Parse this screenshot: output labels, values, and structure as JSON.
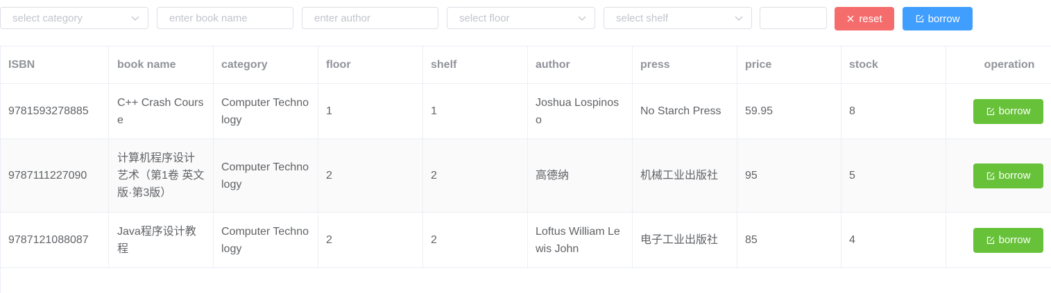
{
  "filters": {
    "category_placeholder": "select category",
    "book_name_placeholder": "enter book name",
    "author_placeholder": "enter author",
    "floor_placeholder": "select floor",
    "shelf_placeholder": "select shelf",
    "extra_value": ""
  },
  "buttons": {
    "reset_label": "reset",
    "borrow_label": "borrow"
  },
  "icons": {
    "select_arrow": "chevron-down-icon",
    "reset": "close-icon",
    "borrow": "edit-icon"
  },
  "colors": {
    "reset": "#f56c6c",
    "borrow_top": "#409eff",
    "borrow_row": "#67c23a"
  },
  "table": {
    "headers": [
      "ISBN",
      "book name",
      "category",
      "floor",
      "shelf",
      "author",
      "press",
      "price",
      "stock",
      "operation"
    ],
    "rows": [
      {
        "isbn": "9781593278885",
        "book_name": "C++ Crash Course",
        "category": "Computer Technology",
        "floor": "1",
        "shelf": "1",
        "author": "Joshua Lospinoso",
        "press": "No Starch Press",
        "price": "59.95",
        "stock": "8",
        "operation": "borrow"
      },
      {
        "isbn": "9787111227090",
        "book_name": "计算机程序设计艺术（第1卷 英文版·第3版）",
        "category": "Computer Technology",
        "floor": "2",
        "shelf": "2",
        "author": "高德纳",
        "press": "机械工业出版社",
        "price": "95",
        "stock": "5",
        "operation": "borrow"
      },
      {
        "isbn": "9787121088087",
        "book_name": "Java程序设计教程",
        "category": "Computer Technology",
        "floor": "2",
        "shelf": "2",
        "author": "Loftus William Lewis John",
        "press": "电子工业出版社",
        "price": "85",
        "stock": "4",
        "operation": "borrow"
      }
    ]
  }
}
